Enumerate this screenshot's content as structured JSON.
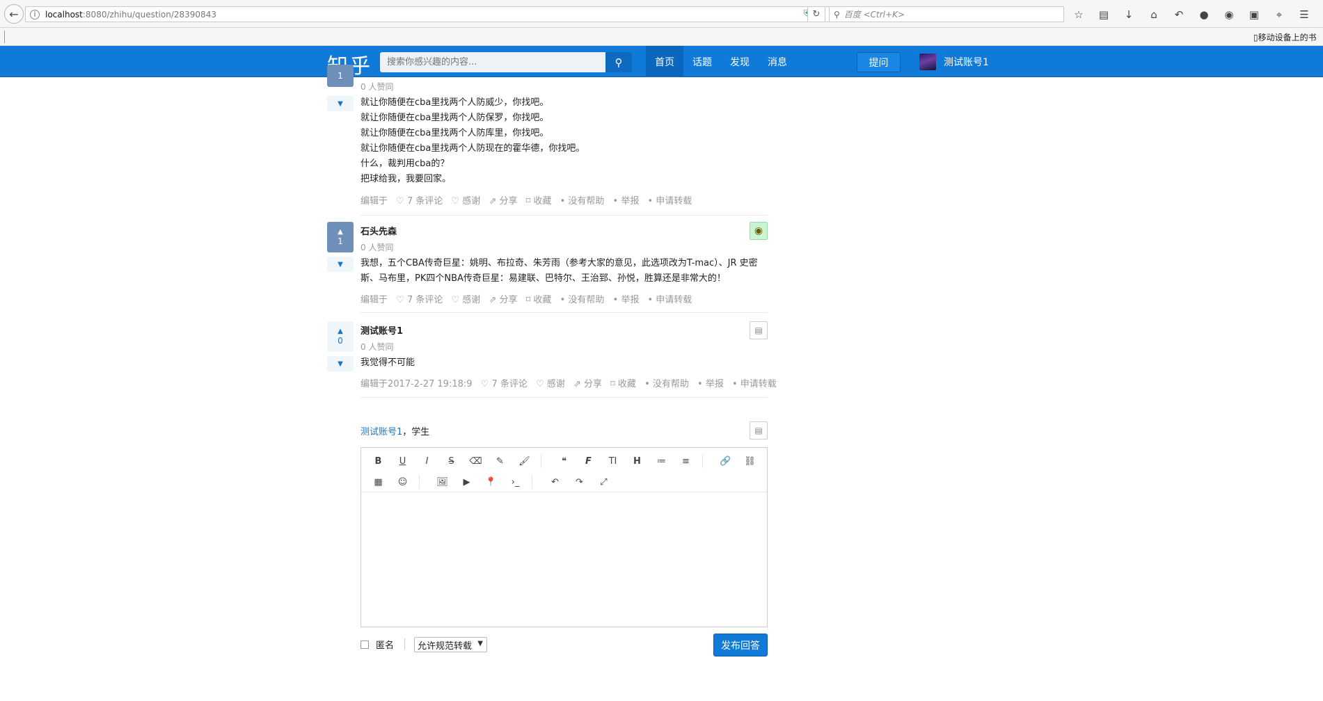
{
  "browser": {
    "url_host": "localhost",
    "url_path": ":8080/zhihu/question/28390843",
    "search_placeholder": "百度 <Ctrl+K>",
    "bookmark_mobile": "移动设备上的书"
  },
  "header": {
    "logo": "知乎",
    "search_placeholder": "搜索你感兴趣的内容...",
    "nav": [
      "首页",
      "话题",
      "发现",
      "消息"
    ],
    "ask_label": "提问",
    "user_name": "测试账号1"
  },
  "answers": [
    {
      "author": "",
      "votes": "1",
      "votes_text": "0 人赞同",
      "lines": [
        "就让你随便在cba里找两个人防威少，你找吧。",
        "就让你随便在cba里找两个人防保罗，你找吧。",
        "就让你随便在cba里找两个人防库里，你找吧。",
        "就让你随便在cba里找两个人防现在的霍华德，你找吧。",
        "什么，裁判用cba的？",
        "把球给我，我要回家。"
      ],
      "meta": [
        "编辑于",
        "♡ 7 条评论",
        "♡ 感谢",
        "⇗ 分享",
        "⌑ 收藏",
        "• 没有帮助",
        "• 举报",
        "• 申请转载"
      ]
    },
    {
      "author": "石头先森",
      "votes": "1",
      "votes_text": "0 人赞同",
      "lines": [
        "我想，五个CBA传奇巨星：姚明、布拉奇、朱芳雨（参考大家的意见，此选项改为T-mac）、JR 史密",
        "斯、马布里，PK四个NBA传奇巨星：易建联、巴特尔、王治郅、孙悦，胜算还是非常大的！"
      ],
      "meta": [
        "编辑于",
        "♡ 7 条评论",
        "♡ 感谢",
        "⇗ 分享",
        "⌑ 收藏",
        "• 没有帮助",
        "• 举报",
        "• 申请转载"
      ]
    },
    {
      "author": "测试账号1",
      "votes": "0",
      "votes_text": "0 人赞同",
      "lines": [
        "我觉得不可能"
      ],
      "meta": [
        "编辑于2017-2-27 19:18:9",
        "♡ 7 条评论",
        "♡ 感谢",
        "⇗ 分享",
        "⌑ 收藏",
        "• 没有帮助",
        "• 举报",
        "• 申请转载"
      ]
    }
  ],
  "editor": {
    "user_name": "测试账号1",
    "user_role": "，学生",
    "toolbar_row1": [
      "B",
      "U",
      "I",
      "S",
      "⌫",
      "✎",
      "🖌",
      "❝",
      "F",
      "TI",
      "H",
      "≔",
      "≡",
      "🔗",
      "⛓"
    ],
    "toolbar_row2": [
      "▦",
      "☺",
      "🖼",
      "▶",
      "📍",
      "›_",
      "↶",
      "↷",
      "⤢"
    ],
    "anonymous_label": "匿名",
    "reprint_select": "允许规范转载",
    "submit_label": "发布回答"
  }
}
